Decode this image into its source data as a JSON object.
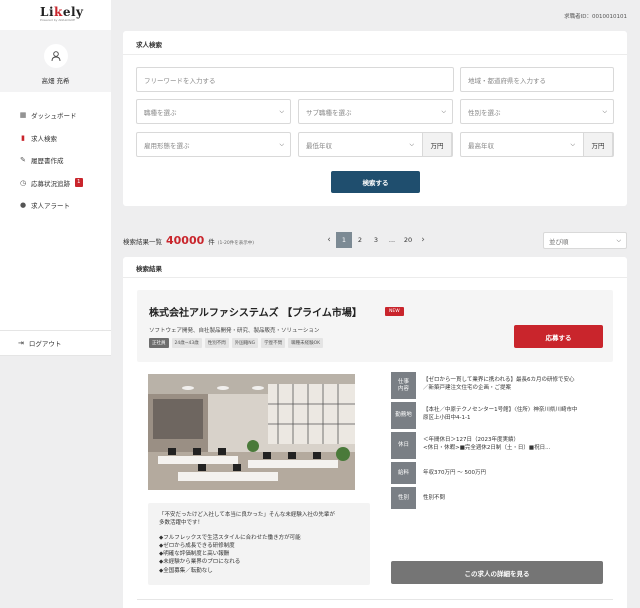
{
  "brand": {
    "logo": "Likely",
    "logo_sub": "Powered by ANALOGUE"
  },
  "user": {
    "name": "高畑 充希",
    "member_id": "求職者ID：0010010101"
  },
  "nav": [
    {
      "label": "ダッシュボード",
      "icon": "grid-icon"
    },
    {
      "label": "求人検索",
      "icon": "file-search-icon"
    },
    {
      "label": "履歴書作成",
      "icon": "pencil-icon"
    },
    {
      "label": "応募状況追跡",
      "icon": "clock-icon",
      "badge": "1"
    },
    {
      "label": "求人アラート",
      "icon": "alert-icon"
    }
  ],
  "logout": "ログアウト",
  "search": {
    "title": "求人検索",
    "freeword_placeholder": "フリーワードを入力する",
    "region_placeholder": "地域・都道府県を入力する",
    "job_type": "職種を選ぶ",
    "sub_job_type": "サブ職種を選ぶ",
    "gender": "性別を選ぶ",
    "employment": "雇用形態を選ぶ",
    "min_salary": "最低年収",
    "max_salary": "最高年収",
    "unit": "万円",
    "button": "検索する"
  },
  "results_meta": {
    "prefix": "検索結果一覧",
    "count": "40000",
    "suffix": "件",
    "range": "(1-20件を表示中)",
    "sort": "並び順"
  },
  "pagination": {
    "pages": [
      "1",
      "2",
      "3",
      "...",
      "20"
    ],
    "prev": "‹",
    "next": "›"
  },
  "results": {
    "title": "検索結果",
    "company": "株式会社アルファシステムズ 【プライム市場】",
    "new_badge": "NEW",
    "description": "ソフトウェア開発、自社製品開発・研究、製品販売・ソリューション",
    "tags": [
      "正社員",
      "24歳~43歳",
      "性別不問",
      "外国籍NG",
      "学歴不問",
      "職種未経験OK"
    ],
    "apply": "応募する",
    "appeal_lines": [
      "「不安だったけど入社して本当に良かった」そんな未経験入社の先輩が",
      "多数活躍中です！",
      "",
      "◆フルフレックスで生活スタイルに合わせた働き方が可能",
      "◆ゼロから成長できる研修制度",
      "◆明確な評価制度と高い報酬",
      "◆未経験から業界のプロになれる",
      "◆全国募集／転勤なし"
    ],
    "info": [
      {
        "label_lines": [
          "仕事",
          "内容"
        ],
        "value_lines": [
          "【ゼロから一貫して業界に携われる】最長6カ月の研修で安心",
          "／新築戸建注文住宅の企画・ご提案"
        ]
      },
      {
        "label_lines": [
          "勤務地"
        ],
        "value_lines": [
          "【本社／中原テクノセンター1号館】〈住所〉神奈川県川崎市中",
          "原区上小田中4-1-1"
        ]
      },
      {
        "label_lines": [
          "休日"
        ],
        "value_lines": [
          "＜年間休日＞127日（2023年度実績）",
          "<休日・休暇>■完全週休2日制（土・日）■祝日..."
        ]
      },
      {
        "label_lines": [
          "給料"
        ],
        "value_lines": [
          "年収370万円 〜 500万円"
        ]
      },
      {
        "label_lines": [
          "性別"
        ],
        "value_lines": [
          "性別不問"
        ]
      }
    ],
    "detail": "この求人の詳細を見る"
  },
  "colors": {
    "accent_red": "#c9252c",
    "navy": "#1f4e6e",
    "gray_button": "#757575"
  }
}
